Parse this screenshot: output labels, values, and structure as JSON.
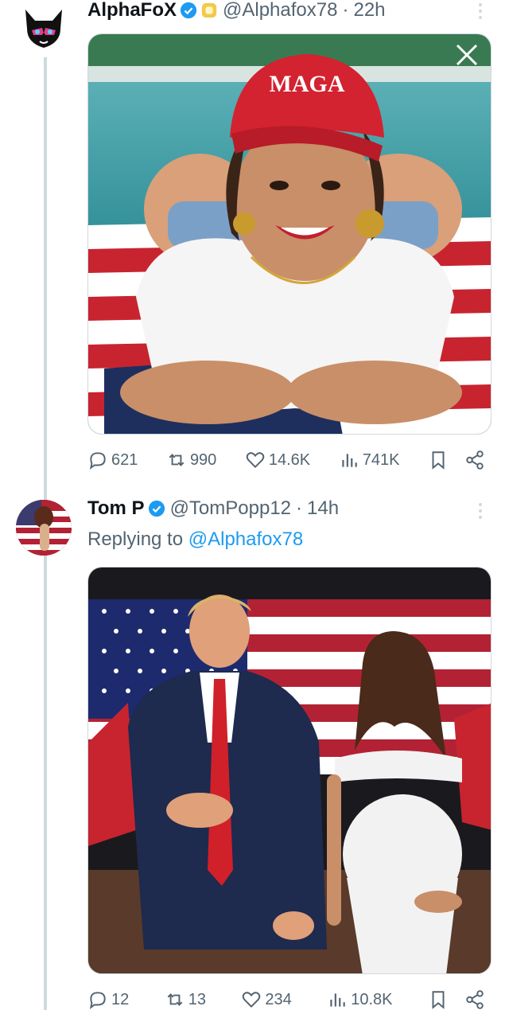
{
  "tweets": [
    {
      "name": "AlphaFoX",
      "handle": "@Alphafox78",
      "separator": "·",
      "time": "22h",
      "media_caption": "MAGA",
      "actions": {
        "replies": "621",
        "retweets": "990",
        "likes": "14.6K",
        "views": "741K"
      }
    },
    {
      "name": "Tom P",
      "handle": "@TomPopp12",
      "separator": "·",
      "time": "14h",
      "replying_prefix": "Replying to",
      "replying_to": "@Alphafox78",
      "actions": {
        "replies": "12",
        "retweets": "13",
        "likes": "234",
        "views": "10.8K"
      }
    }
  ],
  "colors": {
    "accent": "#1d9bf0",
    "secondary_text": "#536471",
    "thread_line": "#cfd9de"
  }
}
